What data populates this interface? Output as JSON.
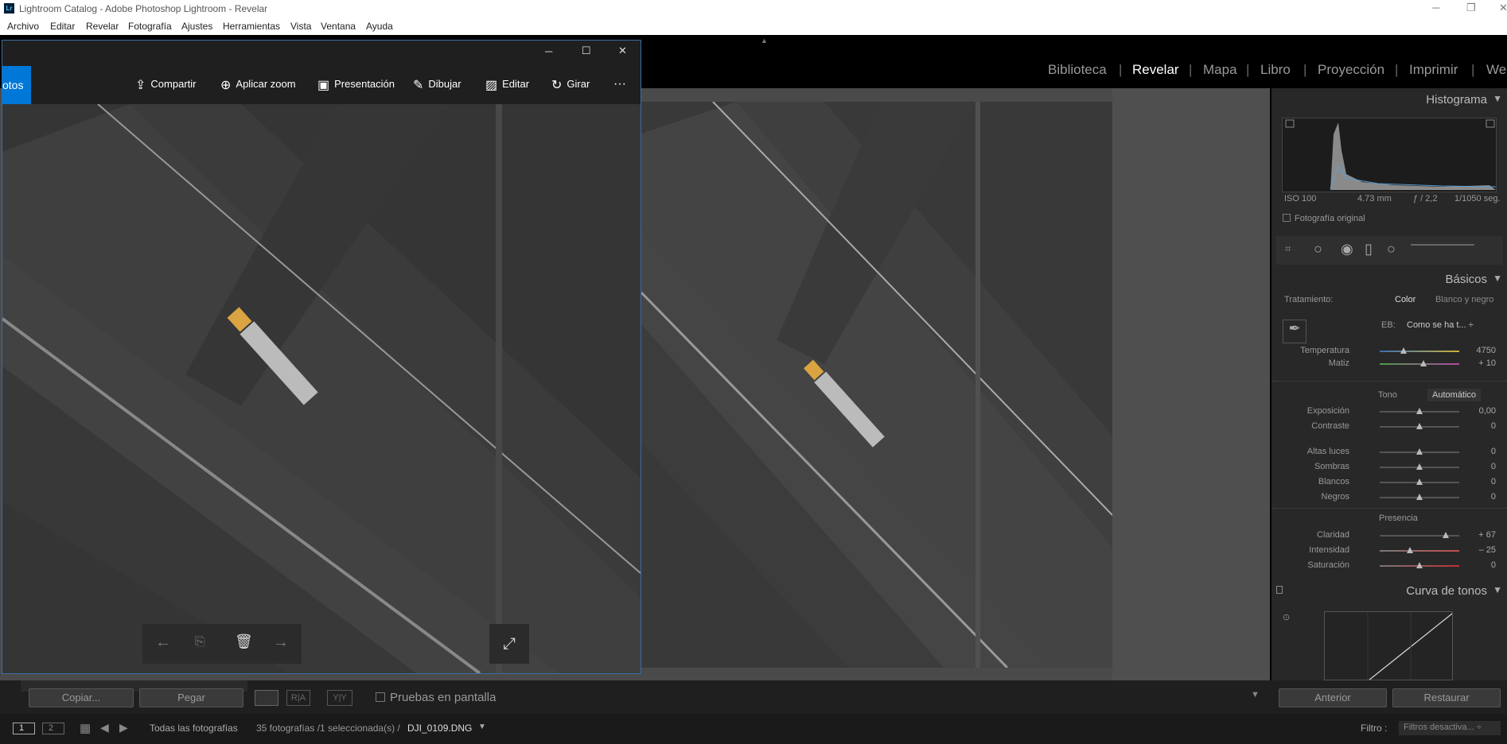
{
  "window": {
    "title": "Lightroom Catalog - Adobe Photoshop Lightroom - Revelar",
    "lr_badge": "Lr"
  },
  "menu": [
    "Archivo",
    "Editar",
    "Revelar",
    "Fotografía",
    "Ajustes",
    "Herramientas",
    "Vista",
    "Ventana",
    "Ayuda"
  ],
  "modules": [
    "Biblioteca",
    "Revelar",
    "Mapa",
    "Libro",
    "Proyección",
    "Imprimir",
    "We"
  ],
  "histogram": {
    "title": "Histograma",
    "iso": "ISO 100",
    "focal": "4.73 mm",
    "aperture": "ƒ / 2,2",
    "shutter": "1/1050 seg.",
    "original_label": "Fotografía original"
  },
  "basic": {
    "title": "Básicos",
    "treatment_label": "Tratamiento:",
    "color": "Color",
    "bw": "Blanco y negro",
    "wb_label": "EB:",
    "wb_value": "Como se ha t... ÷",
    "temperature": {
      "label": "Temperatura",
      "value": "4750",
      "level": 0.3
    },
    "tint": {
      "label": "Matiz",
      "value": "+ 10",
      "level": 0.55
    },
    "tone_label": "Tono",
    "auto": "Automático",
    "exposure": {
      "label": "Exposición",
      "value": "0,00",
      "level": 0.5
    },
    "contrast": {
      "label": "Contraste",
      "value": "0",
      "level": 0.5
    },
    "highlights": {
      "label": "Altas luces",
      "value": "0",
      "level": 0.5
    },
    "shadows": {
      "label": "Sombras",
      "value": "0",
      "level": 0.5
    },
    "whites": {
      "label": "Blancos",
      "value": "0",
      "level": 0.5
    },
    "blacks": {
      "label": "Negros",
      "value": "0",
      "level": 0.5
    },
    "presence_label": "Presencia",
    "clarity": {
      "label": "Claridad",
      "value": "+ 67",
      "level": 0.83
    },
    "vibrance": {
      "label": "Intensidad",
      "value": "– 25",
      "level": 0.38
    },
    "saturation": {
      "label": "Saturación",
      "value": "0",
      "level": 0.5
    }
  },
  "tone_curve": {
    "title": "Curva de tonos"
  },
  "bottom": {
    "copy": "Copiar...",
    "paste": "Pegar",
    "softproof": "Pruebas en pantalla",
    "prev": "Anterior",
    "reset": "Restaurar"
  },
  "filmstrip": {
    "view1": "1",
    "view2": "2",
    "source": "Todas las fotografías",
    "count": "35 fotografías /1 seleccionada(s) /",
    "file": "DJI_0109.DNG",
    "filter_label": "Filtro :",
    "filter_value": "Filtros desactiva... ÷"
  },
  "photos_app": {
    "app": "otos",
    "tools": [
      "Compartir",
      "Aplicar zoom",
      "Presentación",
      "Dibujar",
      "Editar",
      "Girar"
    ],
    "more": "···"
  },
  "colors": {
    "accent": "#0078d7",
    "lr_bg": "#4a4a4a",
    "panel": "#282828"
  }
}
